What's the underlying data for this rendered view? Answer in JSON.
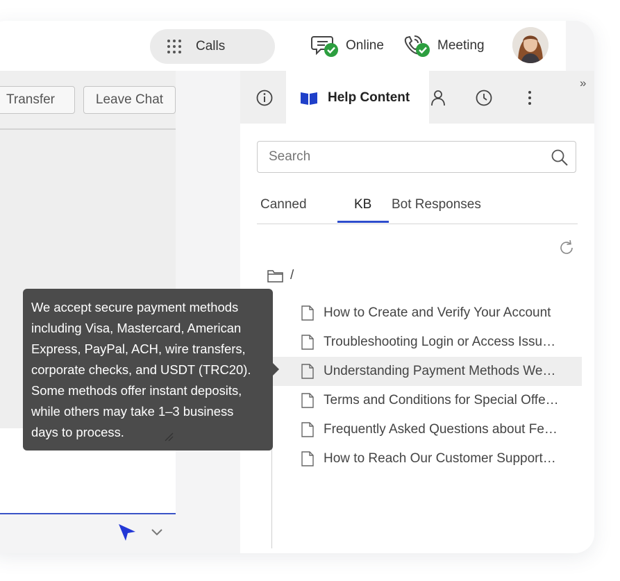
{
  "topbar": {
    "calls_label": "Calls",
    "online_label": "Online",
    "meeting_label": "Meeting"
  },
  "chat": {
    "transfer_label": "Transfer",
    "leave_chat_label": "Leave Chat"
  },
  "panel": {
    "active_tab_label": "Help Content",
    "search_placeholder": "Search",
    "subtabs": [
      "Canned",
      "KB",
      "Bot Responses"
    ],
    "active_subtab": "KB",
    "folder_path": "/",
    "kb_items": [
      "How to Create and Verify Your Account",
      "Troubleshooting Login or Access Issu…",
      "Understanding Payment Methods We…",
      "Terms and Conditions for Special Offe…",
      "Frequently Asked Questions about Fea…",
      "How to Reach Our Customer Support…"
    ],
    "highlighted_item_index": 2
  },
  "tooltip": {
    "lines": [
      "We accept secure payment methods",
      "including Visa, Mastercard, American",
      "Express, PayPal, ACH, wire transfers,",
      "corporate checks, and USDT (TRC20).",
      "Some methods offer instant deposits,",
      "while others may take 1–3 business",
      "days to process."
    ]
  },
  "colors": {
    "accent": "#2d4ccc",
    "online_check": "#2c9e3f",
    "tooltip_bg": "#4b4b4b",
    "send_icon": "#2338d6"
  },
  "icons": [
    "dialpad-icon",
    "online-status-icon",
    "meeting-status-icon",
    "info-icon",
    "book-icon",
    "person-icon",
    "clock-icon",
    "more-icon",
    "collapse-icon",
    "search-icon",
    "refresh-icon",
    "folder-icon",
    "document-icon",
    "send-icon",
    "chevron-down-icon"
  ]
}
